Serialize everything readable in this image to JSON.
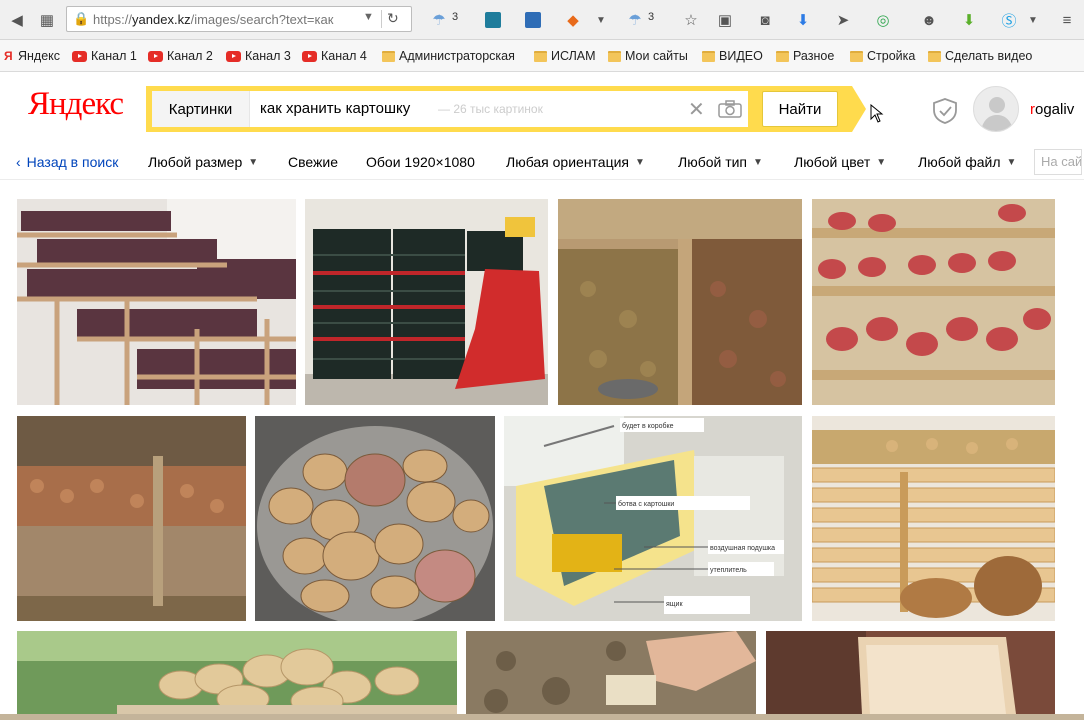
{
  "browser": {
    "url_prefix": "https://",
    "url_host": "yandex.kz",
    "url_rest": "/images/search?text=как",
    "weather_a": "3",
    "weather_b": "3"
  },
  "bookmarks": [
    {
      "label": "Яндекс",
      "icon": "yandex-icon"
    },
    {
      "label": "Канал 1",
      "icon": "youtube-icon"
    },
    {
      "label": "Канал 2",
      "icon": "youtube-icon"
    },
    {
      "label": "Канал 3",
      "icon": "youtube-icon"
    },
    {
      "label": "Канал 4",
      "icon": "youtube-icon"
    },
    {
      "label": "Администраторская",
      "icon": "folder-icon"
    },
    {
      "label": "ИСЛАМ",
      "icon": "folder-icon"
    },
    {
      "label": "Мои сайты",
      "icon": "folder-icon"
    },
    {
      "label": "ВИДЕО",
      "icon": "folder-icon"
    },
    {
      "label": "Разное",
      "icon": "folder-icon"
    },
    {
      "label": "Стройка",
      "icon": "folder-icon"
    },
    {
      "label": "Сделать видео",
      "icon": "folder-icon"
    }
  ],
  "header": {
    "logo": "Яндекс",
    "search_category": "Картинки",
    "search_query": "как хранить картошку",
    "result_count": "— 26 тыс картинок",
    "search_button": "Найти",
    "username_first": "r",
    "username_rest": "ogaliv"
  },
  "filters": {
    "back": "Назад в поиск",
    "size": "Любой размер",
    "fresh": "Свежие",
    "wallpaper": "Обои 1920×1080",
    "orientation": "Любая ориентация",
    "type": "Любой тип",
    "color": "Любой цвет",
    "file": "Любой файл",
    "site_placeholder": "На сайте"
  },
  "images": {
    "labels_tile": [
      "ботва с картошки",
      "будет в коробке",
      "воздушная подушка",
      "утеплитель",
      "ящик"
    ]
  },
  "colors": {
    "yandex_yellow": "#ffdb4d",
    "yandex_red": "#ff0000",
    "link_blue": "#0044bb"
  }
}
